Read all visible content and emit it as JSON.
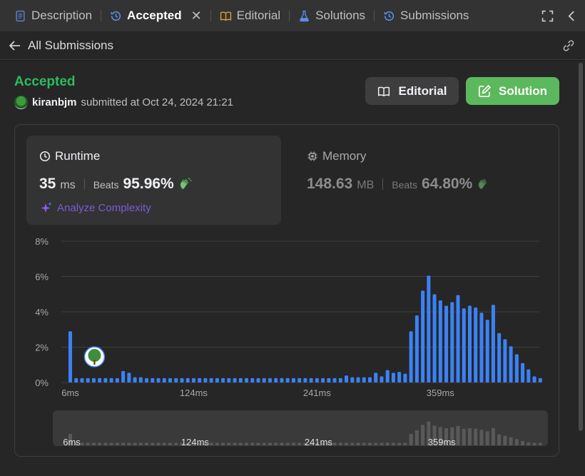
{
  "tabs": [
    {
      "label": "Description",
      "icon": "document-icon",
      "active": false
    },
    {
      "label": "Accepted",
      "icon": "history-icon",
      "active": true
    },
    {
      "label": "Editorial",
      "icon": "book-icon",
      "active": false
    },
    {
      "label": "Solutions",
      "icon": "flask-icon",
      "active": false
    },
    {
      "label": "Submissions",
      "icon": "history-icon",
      "active": false
    }
  ],
  "subbar": {
    "back_label": "All Submissions"
  },
  "submission": {
    "status": "Accepted",
    "username": "kiranbjm",
    "submitted_text": "submitted at Oct 24, 2024 21:21"
  },
  "buttons": {
    "editorial": "Editorial",
    "solution": "Solution"
  },
  "runtime": {
    "title": "Runtime",
    "value": "35",
    "unit": "ms",
    "beats_label": "Beats",
    "beats_value": "95.96%"
  },
  "memory": {
    "title": "Memory",
    "value": "148.63",
    "unit": "MB",
    "beats_label": "Beats",
    "beats_value": "64.80%"
  },
  "analyze_label": "Analyze Complexity",
  "colors": {
    "accepted": "#2cbb5d",
    "bar": "#3b82f6",
    "solution_button": "#5cb85c",
    "analyze": "#7c5bd6"
  },
  "chart_data": {
    "type": "bar",
    "yticks": [
      "0%",
      "2%",
      "4%",
      "6%",
      "8%"
    ],
    "ylim": [
      0,
      8
    ],
    "xticks": [
      "6ms",
      "124ms",
      "241ms",
      "359ms"
    ],
    "xtick_index": [
      0,
      21,
      42,
      63
    ],
    "highlight_index": 4,
    "values": [
      2.9,
      0.25,
      0.25,
      0.25,
      0.25,
      0.25,
      0.25,
      0.25,
      0.25,
      0.65,
      0.55,
      0.3,
      0.3,
      0.25,
      0.25,
      0.25,
      0.25,
      0.25,
      0.25,
      0.25,
      0.25,
      0.25,
      0.25,
      0.25,
      0.25,
      0.25,
      0.25,
      0.25,
      0.25,
      0.25,
      0.25,
      0.25,
      0.25,
      0.25,
      0.25,
      0.25,
      0.25,
      0.25,
      0.25,
      0.25,
      0.25,
      0.25,
      0.25,
      0.25,
      0.25,
      0.25,
      0.25,
      0.4,
      0.3,
      0.3,
      0.3,
      0.3,
      0.55,
      0.35,
      0.7,
      0.55,
      0.6,
      0.5,
      2.9,
      3.8,
      5.2,
      6.05,
      5.0,
      4.65,
      4.35,
      4.55,
      4.95,
      4.2,
      4.35,
      4.25,
      3.95,
      3.55,
      4.4,
      2.8,
      2.45,
      2.05,
      1.6,
      1.1,
      0.75,
      0.35,
      0.25
    ]
  }
}
